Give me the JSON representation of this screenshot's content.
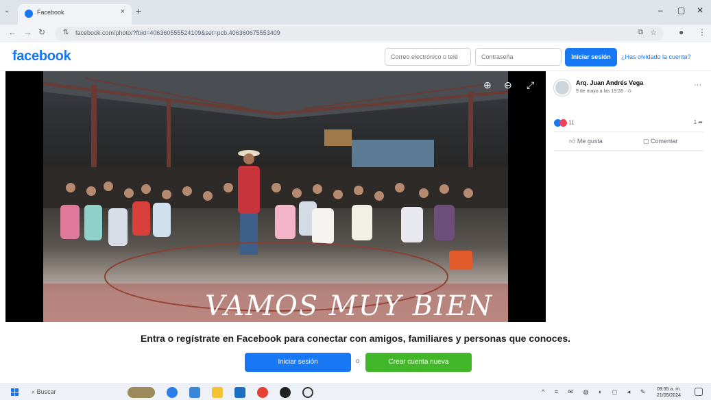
{
  "browser": {
    "tab_title": "Facebook",
    "tab_close": "×",
    "tab_menu": "⌄",
    "new_tab": "+",
    "url": "facebook.com/photo/?fbid=406360555524109&set=pcb.406360675553409",
    "window_controls": [
      "–",
      "▢",
      "✕"
    ]
  },
  "fb_header": {
    "logo": "facebook",
    "email_placeholder": "Correo electrónico o telé",
    "password_placeholder": "Contraseña",
    "login_label": "Iniciar sesión",
    "forgot_label": "¿Has olvidado la cuenta?"
  },
  "photo": {
    "caption": "VAMOS MUY  BIEN"
  },
  "post": {
    "author": "Arq. Juan Andrés Vega",
    "date": "9 de mayo a las 19:28 · ⊙",
    "reaction_count": "11",
    "share_count": "1",
    "like_label": "Me gusta",
    "comment_label": "Comentar",
    "more": "···"
  },
  "signup_prompt": {
    "text": "Entra o regístrate en Facebook para conectar con amigos, familiares y personas que conoces.",
    "login_label": "Iniciar sesión",
    "separator": "o",
    "create_label": "Crear cuenta nueva"
  },
  "taskbar": {
    "search_label": "Buscar",
    "time": "09:55 a. m.",
    "date": "21/05/2024"
  },
  "colors": {
    "brand": "#1877f2",
    "create_green": "#42b72a"
  }
}
